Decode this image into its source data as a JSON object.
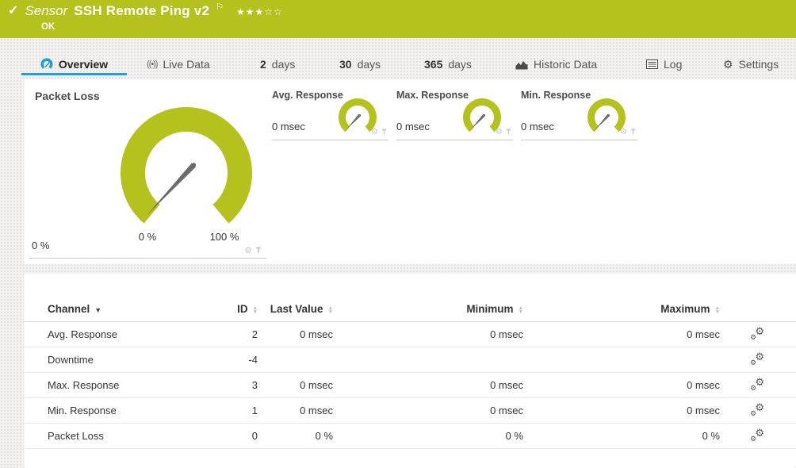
{
  "colors": {
    "brand_green": "#b5c21e",
    "accent_blue": "#1e9fd9",
    "needle_gray": "#6b6b6b",
    "status_ok_color": "#b5c21e"
  },
  "header": {
    "kind_label": "Sensor",
    "title": "SSH Remote Ping v2",
    "status": "OK",
    "rating": {
      "filled_count": 3,
      "empty_count": 2,
      "stars_filled": "★★★",
      "stars_empty": "☆☆"
    }
  },
  "tabs": [
    {
      "label": "Overview",
      "active": true
    },
    {
      "label": "Live Data"
    },
    {
      "num": "2",
      "word": "days"
    },
    {
      "num": "30",
      "word": "days"
    },
    {
      "num": "365",
      "word": "days"
    },
    {
      "label": "Historic Data"
    },
    {
      "label": "Log"
    },
    {
      "label": "Settings"
    }
  ],
  "gauges": {
    "main": {
      "title": "Packet Loss",
      "value": "0 %",
      "scale_min": "0 %",
      "scale_max": "100 %"
    },
    "mini": [
      {
        "title": "Avg. Response",
        "value": "0 msec"
      },
      {
        "title": "Max. Response",
        "value": "0 msec"
      },
      {
        "title": "Min. Response",
        "value": "0 msec"
      }
    ]
  },
  "table": {
    "headers": {
      "channel": "Channel",
      "id": "ID",
      "last_value": "Last Value",
      "minimum": "Minimum",
      "maximum": "Maximum"
    },
    "rows": [
      {
        "channel": "Avg. Response",
        "id": "2",
        "last": "0 msec",
        "min": "0 msec",
        "max": "0 msec"
      },
      {
        "channel": "Downtime",
        "id": "-4",
        "last": "",
        "min": "",
        "max": ""
      },
      {
        "channel": "Max. Response",
        "id": "3",
        "last": "0 msec",
        "min": "0 msec",
        "max": "0 msec"
      },
      {
        "channel": "Min. Response",
        "id": "1",
        "last": "0 msec",
        "min": "0 msec",
        "max": "0 msec"
      },
      {
        "channel": "Packet Loss",
        "id": "0",
        "last": "0 %",
        "min": "0 %",
        "max": "0 %"
      }
    ]
  }
}
